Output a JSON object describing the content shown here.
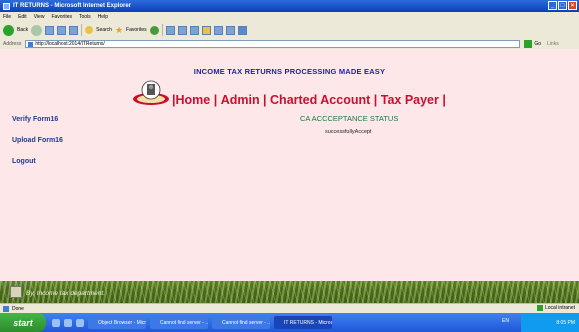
{
  "window": {
    "title": "IT RETURNS - Microsoft Internet Explorer"
  },
  "menu": [
    "File",
    "Edit",
    "View",
    "Favorites",
    "Tools",
    "Help"
  ],
  "toolbar": {
    "back": "Back",
    "search": "Search",
    "favorites": "Favorites"
  },
  "address": {
    "label": "Address",
    "url": "http://localhost:2014/ITReturns/",
    "go": "Go",
    "links": "Links"
  },
  "page": {
    "title": "INCOME TAX RETURNS PROCESSING MADE EASY",
    "nav": [
      "|Home |",
      "Admin |",
      "Charted Account |",
      "Tax Payer |"
    ],
    "status_title": "CA ACCCEPTANCE STATUS",
    "status_message": "successfullyAccept",
    "sidebar": [
      "Verify Form16",
      "Upload Form16",
      "Logout"
    ],
    "footer": "By, Income tax department."
  },
  "statusbar": {
    "text": "Done",
    "zone": "Local intranet"
  },
  "taskbar": {
    "start": "start",
    "tasks": [
      "Object Browser - Micr...",
      "Cannot find server - ...",
      "Cannot find server - ...",
      "IT RETURNS - Micros..."
    ],
    "lang": "EN",
    "clock": "8:05 PM"
  },
  "colors": {
    "content_bg": "#fde7e8",
    "nav": "#c8102e",
    "title": "#1f1f9e",
    "status": "#157a46",
    "links": "#1f3b8f"
  }
}
